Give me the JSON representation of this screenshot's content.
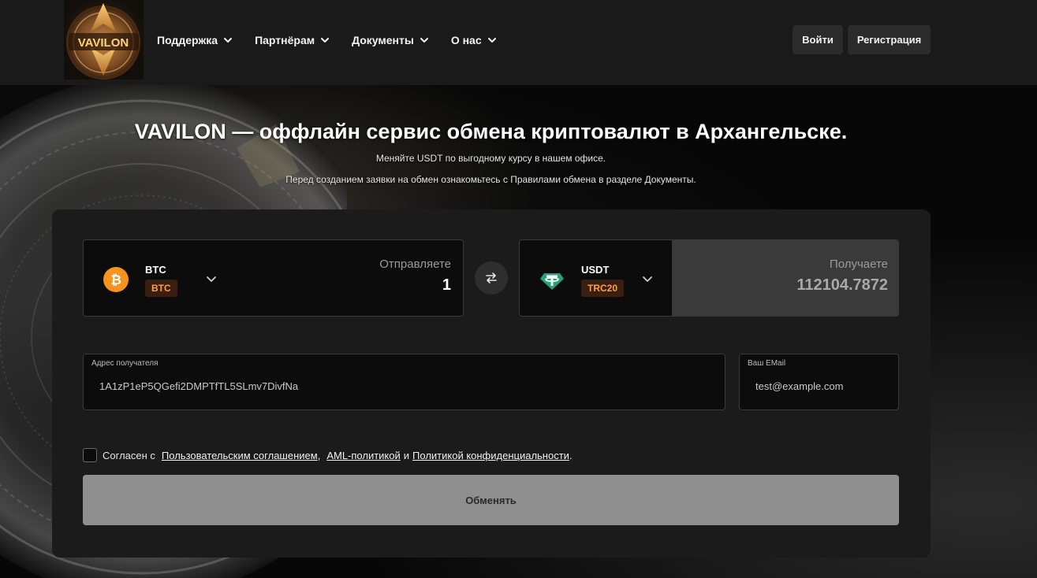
{
  "header": {
    "logo_text": "VAVILON",
    "nav": [
      {
        "label": "Поддержка"
      },
      {
        "label": "Партнёрам"
      },
      {
        "label": "Документы"
      },
      {
        "label": "О нас"
      }
    ],
    "login_label": "Войти",
    "register_label": "Регистрация"
  },
  "hero": {
    "title": "VAVILON — оффлайн сервис обмена криптовалют в Архангельске.",
    "subtitle1": "Меняйте USDT по выгодному курсу в нашем офисе.",
    "subtitle2": "Перед созданием заявки на обмен ознакомьтесь с Правилами обмена в разделе Документы."
  },
  "exchange": {
    "send": {
      "currency": "BTC",
      "network": "BTC",
      "label": "Отправляете",
      "amount": "1",
      "icon": "bitcoin-icon",
      "color": "#f7931a"
    },
    "receive": {
      "currency": "USDT",
      "network": "TRC20",
      "label": "Получаете",
      "amount": "112104.7872",
      "icon": "tether-icon",
      "color": "#26a17b"
    },
    "address": {
      "label": "Адрес получателя",
      "value": "1A1zP1eP5QGefi2DMPTfTL5SLmv7DivfNa"
    },
    "email": {
      "label": "Ваш EMail",
      "value": "test@example.com"
    },
    "agreement": {
      "prefix": "Согласен с",
      "link1": "Пользовательским соглашением",
      "sep": ",",
      "link2": "AML-политикой",
      "and": "и",
      "link3": "Политикой конфиденциальности",
      "suffix": "."
    },
    "submit_label": "Обменять"
  }
}
